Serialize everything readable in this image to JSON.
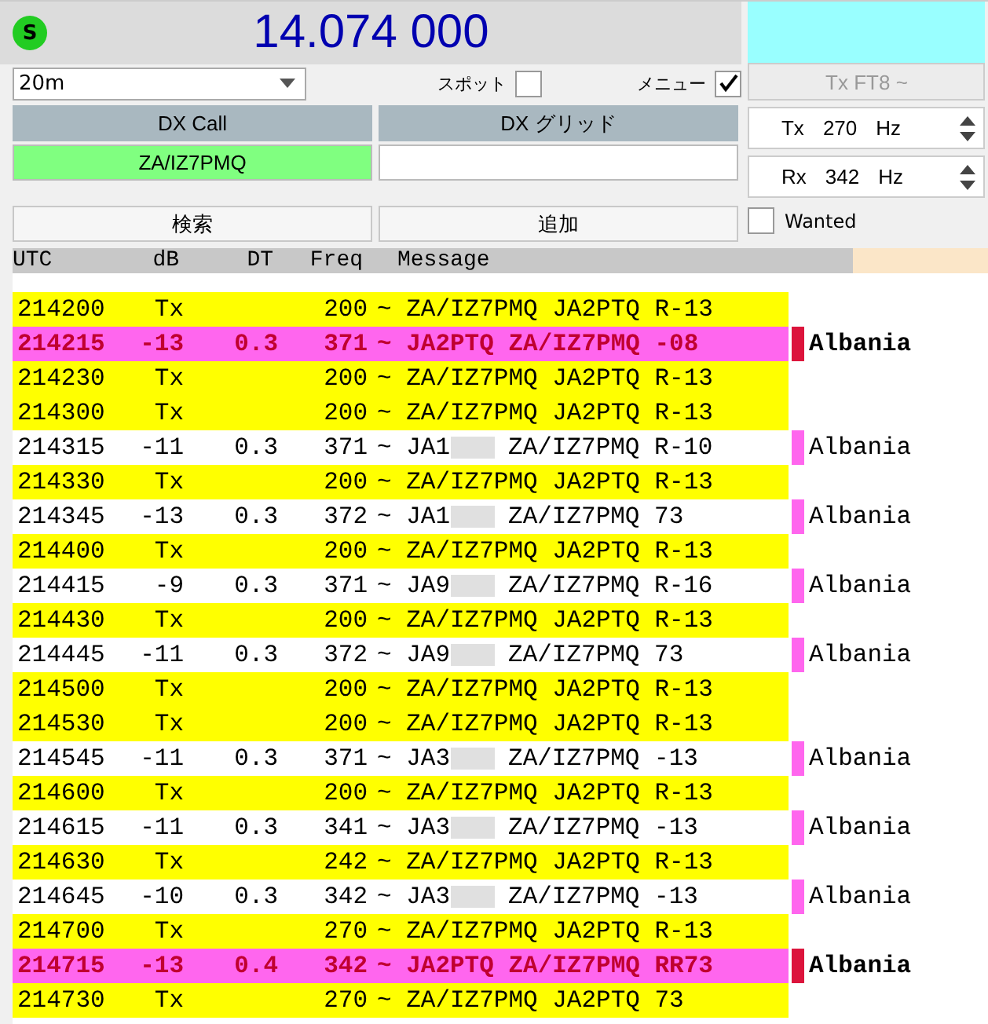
{
  "frequency": "14.074 000",
  "status_badge": "S",
  "band": "20m",
  "spot": {
    "label": "スポット",
    "checked": false
  },
  "menu": {
    "label": "メニュー",
    "checked": true
  },
  "tx_mode_button": {
    "label": "Tx FT8 ~",
    "disabled": true
  },
  "dx_call": {
    "label": "DX Call",
    "value": "ZA/IZ7PMQ"
  },
  "dx_grid": {
    "label": "DX グリッド"
  },
  "tx_freq": {
    "prefix": "Tx",
    "value": "270",
    "unit": "Hz"
  },
  "rx_freq": {
    "prefix": "Rx",
    "value": "342",
    "unit": "Hz"
  },
  "search_button": "検索",
  "add_button": "追加",
  "wanted": {
    "label": "Wanted",
    "checked": false
  },
  "columns": [
    "UTC",
    "dB",
    "DT",
    "Freq",
    "Message"
  ],
  "rows": [
    {
      "kind": "tx",
      "utc": "214200",
      "db": "Tx",
      "freq": "200",
      "message": "~ ZA/IZ7PMQ JA2PTQ R-13"
    },
    {
      "kind": "to_me",
      "utc": "214215",
      "db": "-13",
      "dt": "0.3",
      "freq": "371",
      "message": "~ JA2PTQ ZA/IZ7PMQ -08",
      "country": "Albania",
      "color": "#dc143c"
    },
    {
      "kind": "tx",
      "utc": "214230",
      "db": "Tx",
      "freq": "200",
      "message": "~ ZA/IZ7PMQ JA2PTQ R-13"
    },
    {
      "kind": "tx",
      "utc": "214300",
      "db": "Tx",
      "freq": "200",
      "message": "~ ZA/IZ7PMQ JA2PTQ R-13"
    },
    {
      "kind": "rx",
      "utc": "214315",
      "db": "-11",
      "dt": "0.3",
      "freq": "371",
      "message": "~ JA1",
      "blurred": true,
      "message_end": "ZA/IZ7PMQ R-10",
      "country": "Albania",
      "color": "#ff66ee"
    },
    {
      "kind": "tx",
      "utc": "214330",
      "db": "Tx",
      "freq": "200",
      "message": "~ ZA/IZ7PMQ JA2PTQ R-13"
    },
    {
      "kind": "rx",
      "utc": "214345",
      "db": "-13",
      "dt": "0.3",
      "freq": "372",
      "message": "~ JA1",
      "blurred": true,
      "message_end": "ZA/IZ7PMQ 73",
      "country": "Albania",
      "color": "#ff66ee"
    },
    {
      "kind": "tx",
      "utc": "214400",
      "db": "Tx",
      "freq": "200",
      "message": "~ ZA/IZ7PMQ JA2PTQ R-13"
    },
    {
      "kind": "rx",
      "utc": "214415",
      "db": "-9",
      "dt": "0.3",
      "freq": "371",
      "message": "~ JA9",
      "blurred": true,
      "message_end": "ZA/IZ7PMQ R-16",
      "country": "Albania",
      "color": "#ff66ee"
    },
    {
      "kind": "tx",
      "utc": "214430",
      "db": "Tx",
      "freq": "200",
      "message": "~ ZA/IZ7PMQ JA2PTQ R-13"
    },
    {
      "kind": "rx",
      "utc": "214445",
      "db": "-11",
      "dt": "0.3",
      "freq": "372",
      "message": "~ JA9",
      "blurred": true,
      "message_end": "ZA/IZ7PMQ 73",
      "country": "Albania",
      "color": "#ff66ee"
    },
    {
      "kind": "tx",
      "utc": "214500",
      "db": "Tx",
      "freq": "200",
      "message": "~ ZA/IZ7PMQ JA2PTQ R-13"
    },
    {
      "kind": "tx",
      "utc": "214530",
      "db": "Tx",
      "freq": "200",
      "message": "~ ZA/IZ7PMQ JA2PTQ R-13"
    },
    {
      "kind": "rx",
      "utc": "214545",
      "db": "-11",
      "dt": "0.3",
      "freq": "371",
      "message": "~ JA3",
      "blurred": true,
      "message_end": "ZA/IZ7PMQ -13",
      "country": "Albania",
      "color": "#ff66ee"
    },
    {
      "kind": "tx",
      "utc": "214600",
      "db": "Tx",
      "freq": "200",
      "message": "~ ZA/IZ7PMQ JA2PTQ R-13"
    },
    {
      "kind": "rx",
      "utc": "214615",
      "db": "-11",
      "dt": "0.3",
      "freq": "341",
      "message": "~ JA3",
      "blurred": true,
      "message_end": "ZA/IZ7PMQ -13",
      "country": "Albania",
      "color": "#ff66ee"
    },
    {
      "kind": "tx",
      "utc": "214630",
      "db": "Tx",
      "freq": "242",
      "message": "~ ZA/IZ7PMQ JA2PTQ R-13"
    },
    {
      "kind": "rx",
      "utc": "214645",
      "db": "-10",
      "dt": "0.3",
      "freq": "342",
      "message": "~ JA3",
      "blurred": true,
      "message_end": "ZA/IZ7PMQ -13",
      "country": "Albania",
      "color": "#ff66ee"
    },
    {
      "kind": "tx",
      "utc": "214700",
      "db": "Tx",
      "freq": "270",
      "message": "~ ZA/IZ7PMQ JA2PTQ R-13"
    },
    {
      "kind": "to_me",
      "utc": "214715",
      "db": "-13",
      "dt": "0.4",
      "freq": "342",
      "message": "~ JA2PTQ ZA/IZ7PMQ RR73",
      "country": "Albania",
      "color": "#dc143c"
    },
    {
      "kind": "tx",
      "utc": "214730",
      "db": "Tx",
      "freq": "270",
      "message": "~ ZA/IZ7PMQ JA2PTQ 73"
    }
  ]
}
